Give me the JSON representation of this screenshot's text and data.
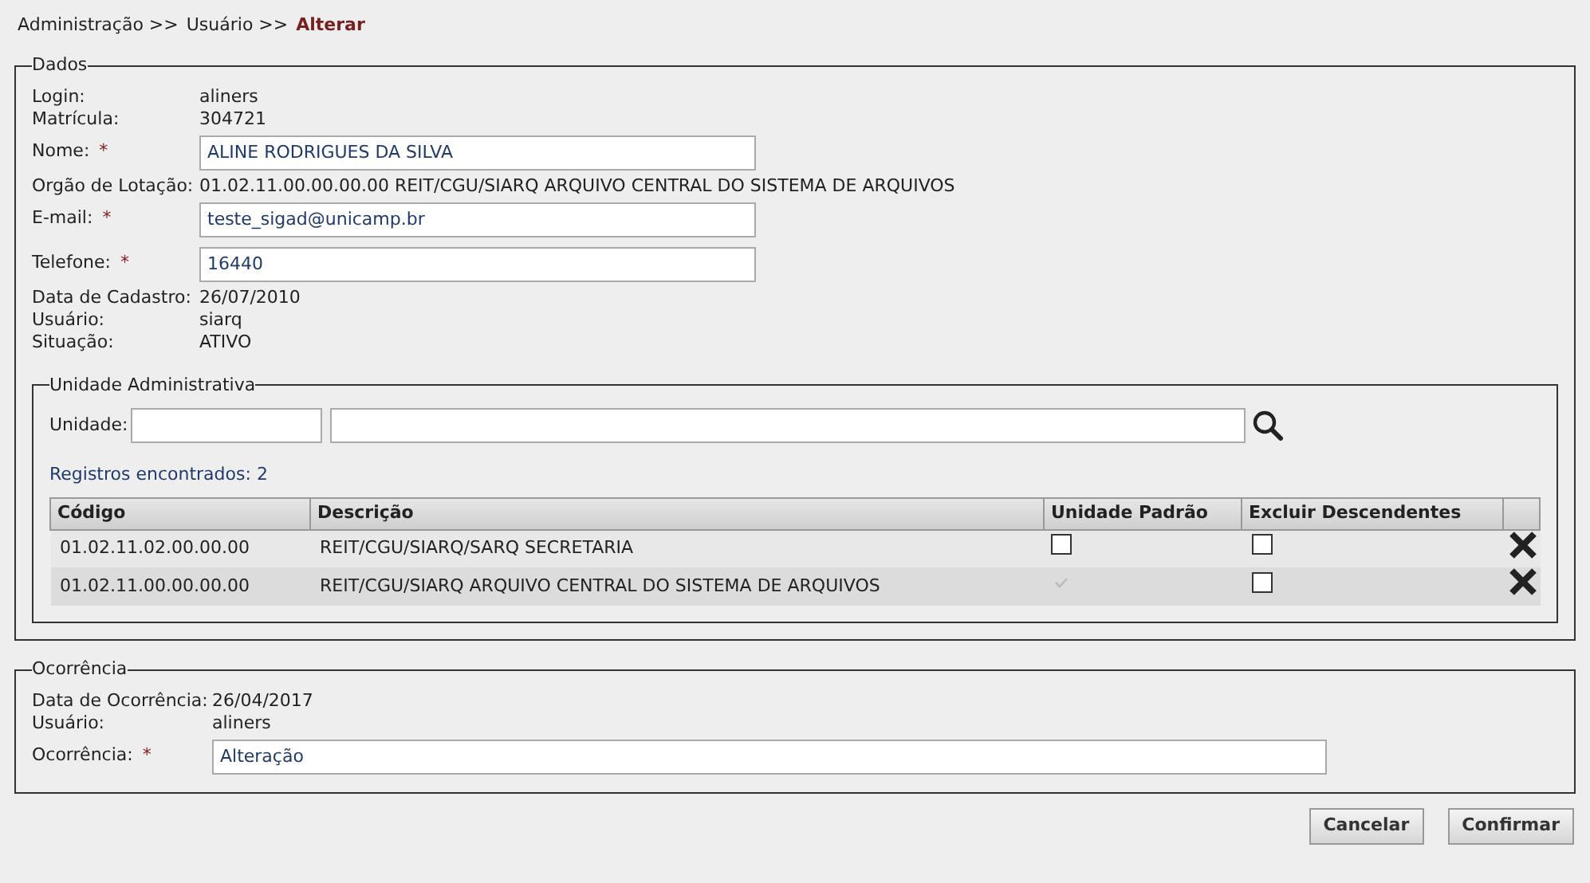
{
  "breadcrumb": [
    {
      "text": "Administração >>",
      "current": false
    },
    {
      "text": "Usuário >>",
      "current": false
    },
    {
      "text": "Alterar",
      "current": true
    }
  ],
  "dados": {
    "legend": "Dados",
    "fields": [
      {
        "kind": "text",
        "label": "Login:",
        "value": "aliners"
      },
      {
        "kind": "text",
        "label": "Matrícula:",
        "value": "304721"
      },
      {
        "kind": "input",
        "label": "Nome:",
        "required_mark": "*",
        "value": "ALINE RODRIGUES DA SILVA"
      },
      {
        "kind": "text",
        "label": "Orgão de Lotação:",
        "value": "01.02.11.00.00.00.00 REIT/CGU/SIARQ ARQUIVO CENTRAL DO SISTEMA DE ARQUIVOS"
      },
      {
        "kind": "input",
        "label": "E-mail:",
        "required_mark": "*",
        "value": "teste_sigad@unicamp.br"
      },
      {
        "kind": "input",
        "label": "Telefone:",
        "required_mark": "*",
        "value": "16440"
      },
      {
        "kind": "text",
        "label": "Data de Cadastro:",
        "value": "26/07/2010"
      },
      {
        "kind": "text",
        "label": "Usuário:",
        "value": "siarq"
      },
      {
        "kind": "text",
        "label": "Situação:",
        "value": "ATIVO"
      }
    ]
  },
  "unidade": {
    "legend": "Unidade Administrativa",
    "label": "Unidade:",
    "records": "Registros encontrados: 2",
    "columns": [
      "Código",
      "Descrição",
      "Unidade Padrão",
      "Excluir Descendentes"
    ],
    "rows": [
      {
        "codigo": "01.02.11.02.00.00.00",
        "descricao": "REIT/CGU/SIARQ/SARQ SECRETARIA",
        "padrao": false,
        "padrao_disabled": false,
        "excluir": false
      },
      {
        "codigo": "01.02.11.00.00.00.00",
        "descricao": "REIT/CGU/SIARQ ARQUIVO CENTRAL DO SISTEMA DE ARQUIVOS",
        "padrao": true,
        "padrao_disabled": true,
        "excluir": false
      }
    ]
  },
  "ocorrencia": {
    "legend": "Ocorrência",
    "fields": [
      {
        "kind": "text",
        "label": "Data de Ocorrência:",
        "value": "26/04/2017"
      },
      {
        "kind": "text",
        "label": "Usuário:",
        "value": "aliners"
      },
      {
        "kind": "input",
        "label": "Ocorrência:",
        "required_mark": "*",
        "value": "Alteração"
      }
    ]
  },
  "buttons": [
    "Cancelar",
    "Confirmar"
  ]
}
